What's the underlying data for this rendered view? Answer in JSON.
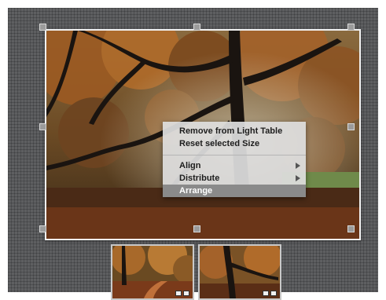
{
  "context_menu": {
    "items": [
      {
        "label": "Remove from Light Table",
        "submenu": false,
        "highlighted": false
      },
      {
        "label": "Reset selected Size",
        "submenu": false,
        "highlighted": false
      },
      {
        "label": "Align",
        "submenu": true,
        "highlighted": false
      },
      {
        "label": "Distribute",
        "submenu": true,
        "highlighted": false
      },
      {
        "label": "Arrange",
        "submenu": false,
        "highlighted": true
      }
    ]
  },
  "icons": {
    "submenu": "chevron-right-icon",
    "thumb_badge": "image-badge-icon"
  },
  "colors": {
    "lighttable_bg": "#5e5f61",
    "menu_bg": "#dedede",
    "menu_highlight": "#8a8a8a",
    "frame_border": "#f2f2f2"
  }
}
